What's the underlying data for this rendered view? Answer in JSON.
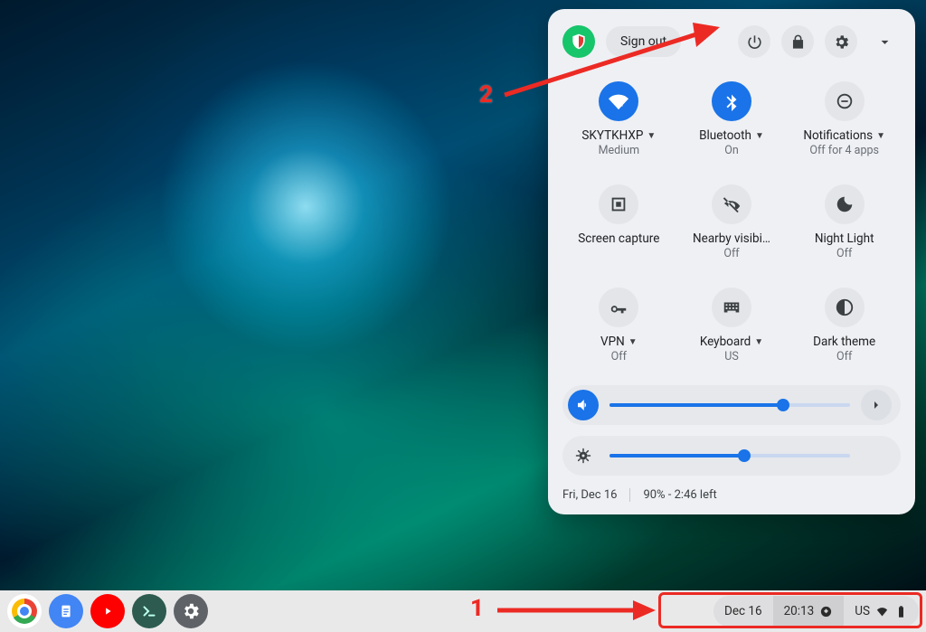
{
  "annotations": {
    "label_1": "1",
    "label_2": "2"
  },
  "panel": {
    "signout_label": "Sign out",
    "tiles": [
      {
        "title": "SKYTKHXP",
        "sub": "Medium",
        "has_caret": true,
        "active": true,
        "icon": "wifi-lock"
      },
      {
        "title": "Bluetooth",
        "sub": "On",
        "has_caret": true,
        "active": true,
        "icon": "bluetooth"
      },
      {
        "title": "Notifications",
        "sub": "Off for 4 apps",
        "has_caret": true,
        "active": false,
        "icon": "dnd"
      },
      {
        "title": "Screen capture",
        "sub": "",
        "has_caret": false,
        "active": false,
        "icon": "screen-capture"
      },
      {
        "title": "Nearby visibi…",
        "sub": "Off",
        "has_caret": false,
        "active": false,
        "icon": "visibility-off"
      },
      {
        "title": "Night Light",
        "sub": "Off",
        "has_caret": false,
        "active": false,
        "icon": "night-light"
      },
      {
        "title": "VPN",
        "sub": "Off",
        "has_caret": true,
        "active": false,
        "icon": "vpn-key"
      },
      {
        "title": "Keyboard",
        "sub": "US",
        "has_caret": true,
        "active": false,
        "icon": "keyboard"
      },
      {
        "title": "Dark theme",
        "sub": "Off",
        "has_caret": false,
        "active": false,
        "icon": "dark-theme"
      }
    ],
    "volume_pct": 72,
    "brightness_pct": 56,
    "footer_date": "Fri, Dec 16",
    "footer_battery": "90% - 2:46 left"
  },
  "shelf": {
    "apps": [
      {
        "name": "chrome"
      },
      {
        "name": "google-docs"
      },
      {
        "name": "youtube"
      },
      {
        "name": "terminal"
      },
      {
        "name": "settings"
      }
    ],
    "tray": {
      "date": "Dec 16",
      "time": "20:13",
      "ime": "US"
    }
  }
}
